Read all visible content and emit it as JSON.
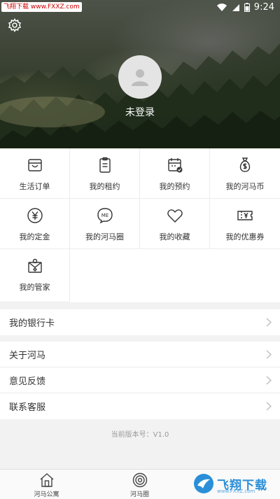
{
  "status_bar": {
    "time": "9:24",
    "watermark": "飞翔下载 www.FXXZ.com",
    "icons": [
      "wifi-icon",
      "signal-icon",
      "battery-icon"
    ]
  },
  "header": {
    "settings_icon": "gear-icon",
    "avatar_icon": "user-silhouette-icon",
    "login_label": "未登录"
  },
  "menu_grid": [
    {
      "label": "生活订单",
      "icon": "bag-icon"
    },
    {
      "label": "我的租约",
      "icon": "clipboard-icon"
    },
    {
      "label": "我的预约",
      "icon": "calendar-check-icon"
    },
    {
      "label": "我的河马币",
      "icon": "money-bag-icon"
    },
    {
      "label": "我的定金",
      "icon": "yen-circle-icon"
    },
    {
      "label": "我的河马圈",
      "icon": "me-bubble-icon"
    },
    {
      "label": "我的收藏",
      "icon": "heart-icon"
    },
    {
      "label": "我的优惠券",
      "icon": "coupon-icon"
    },
    {
      "label": "我的管家",
      "icon": "butler-icon"
    }
  ],
  "list_section_1": [
    {
      "label": "我的银行卡"
    }
  ],
  "list_section_2": [
    {
      "label": "关于河马"
    },
    {
      "label": "意见反馈"
    },
    {
      "label": "联系客服"
    }
  ],
  "version_text": "当前版本号：V1.0",
  "tab_bar": [
    {
      "label": "河马公寓",
      "icon": "house-icon"
    },
    {
      "label": "河马圈",
      "icon": "target-circle-icon"
    }
  ],
  "watermark_bottom": {
    "text": "飞翔下载",
    "url": "www.FXXZ.com"
  },
  "colors": {
    "accent_blue": "#2a8fd8",
    "text_primary": "#333333",
    "background": "#f2f2f2"
  }
}
